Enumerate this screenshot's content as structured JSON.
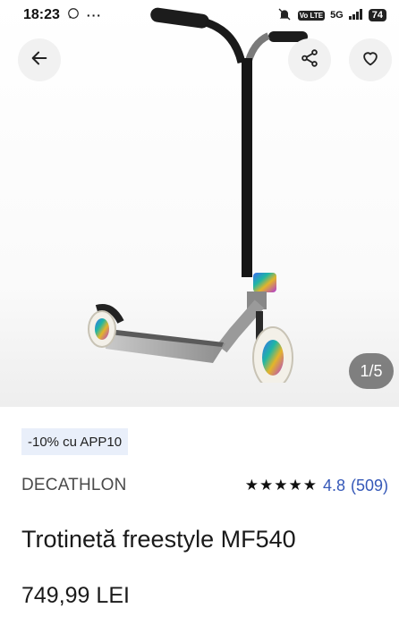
{
  "status_bar": {
    "time": "18:23",
    "volte": "Vo LTE",
    "network": "5G",
    "battery": "74"
  },
  "gallery": {
    "pager": "1/5"
  },
  "promo": {
    "label": "-10% cu APP10"
  },
  "product": {
    "brand": "DECATHLON",
    "stars": "★★★★★",
    "rating": "4.8",
    "review_count": "(509)",
    "title": "Trotinetă freestyle MF540",
    "price": "749,99 LEI"
  },
  "colors": {
    "accent_link": "#3558b8",
    "promo_bg": "#e9effa",
    "button_bg": "#f1f1f1"
  },
  "icons": {
    "back": "arrow-left-icon",
    "share": "share-icon",
    "favorite": "heart-icon"
  }
}
